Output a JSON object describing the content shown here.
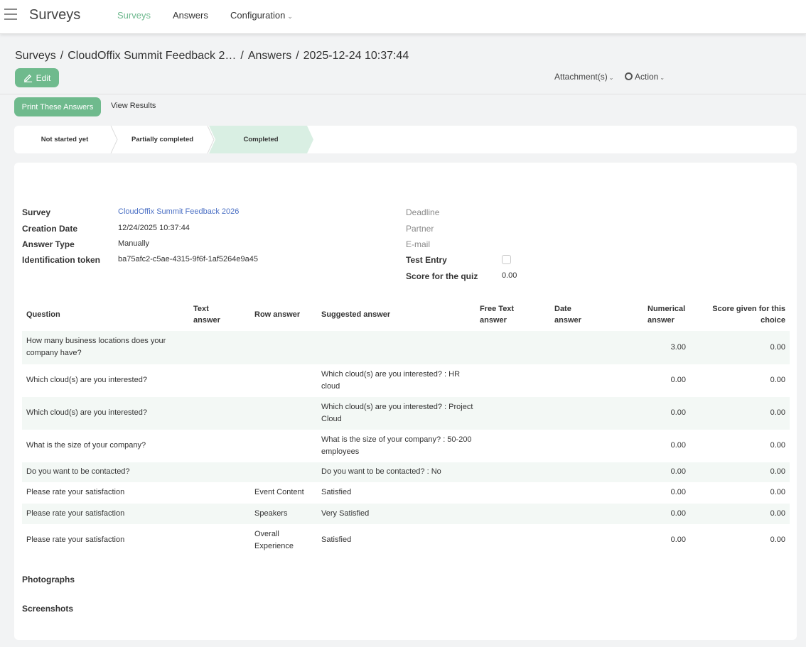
{
  "app": {
    "name": "Surveys"
  },
  "nav": {
    "surveys": "Surveys",
    "answers": "Answers",
    "configuration": "Configuration"
  },
  "breadcrumb": [
    "Surveys",
    "CloudOffix Summit Feedback 2…",
    "Answers",
    "2025-12-24 10:37:44"
  ],
  "actions": {
    "edit": "Edit",
    "attachments": "Attachment(s)",
    "action": "Action",
    "print": "Print These Answers",
    "view_results": "View Results"
  },
  "stages": [
    "Not started yet",
    "Partially completed",
    "Completed"
  ],
  "active_stage": "Completed",
  "fields": {
    "survey_label": "Survey",
    "survey_value": "CloudOffix Summit Feedback 2026",
    "creation_date_label": "Creation Date",
    "creation_date_value": "12/24/2025 10:37:44",
    "answer_type_label": "Answer Type",
    "answer_type_value": "Manually",
    "token_label": "Identification token",
    "token_value": "ba75afc2-c5ae-4315-9f6f-1af5264e9a45",
    "deadline_label": "Deadline",
    "partner_label": "Partner",
    "email_label": "E-mail",
    "test_entry_label": "Test Entry",
    "test_entry_checked": false,
    "score_label": "Score for the quiz",
    "score_value": "0.00"
  },
  "table": {
    "headers": {
      "question": "Question",
      "text_answer": "Text answer",
      "row_answer": "Row answer",
      "suggested_answer": "Suggested answer",
      "free_text": "Free Text answer",
      "date_answer": "Date answer",
      "numerical": "Numerical answer",
      "score": "Score given for this choice"
    },
    "rows": [
      {
        "question": "How many business locations does your company have?",
        "row_answer": "",
        "suggested": "",
        "numerical": "3.00",
        "score": "0.00"
      },
      {
        "question": "Which cloud(s) are you interested?",
        "row_answer": "",
        "suggested": "Which cloud(s) are you interested? : HR cloud",
        "numerical": "0.00",
        "score": "0.00"
      },
      {
        "question": "Which cloud(s) are you interested?",
        "row_answer": "",
        "suggested": "Which cloud(s) are you interested? : Project Cloud",
        "numerical": "0.00",
        "score": "0.00"
      },
      {
        "question": "What is the size of your company?",
        "row_answer": "",
        "suggested": "What is the size of your company? : 50-200 employees",
        "numerical": "0.00",
        "score": "0.00"
      },
      {
        "question": "Do you want to be contacted?",
        "row_answer": "",
        "suggested": "Do you want to be contacted? : No",
        "numerical": "0.00",
        "score": "0.00"
      },
      {
        "question": "Please rate your satisfaction",
        "row_answer": "Event Content",
        "suggested": "Satisfied",
        "numerical": "0.00",
        "score": "0.00"
      },
      {
        "question": "Please rate your satisfaction",
        "row_answer": "Speakers",
        "suggested": "Very Satisfied",
        "numerical": "0.00",
        "score": "0.00"
      },
      {
        "question": "Please rate your satisfaction",
        "row_answer": "Overall Experience",
        "suggested": "Satisfied",
        "numerical": "0.00",
        "score": "0.00"
      }
    ]
  },
  "sections": {
    "photographs": "Photographs",
    "screenshots": "Screenshots"
  },
  "colors": {
    "accent": "#6fba8d",
    "active_stage_bg": "#d9efe3",
    "link": "#4a6fc4"
  }
}
